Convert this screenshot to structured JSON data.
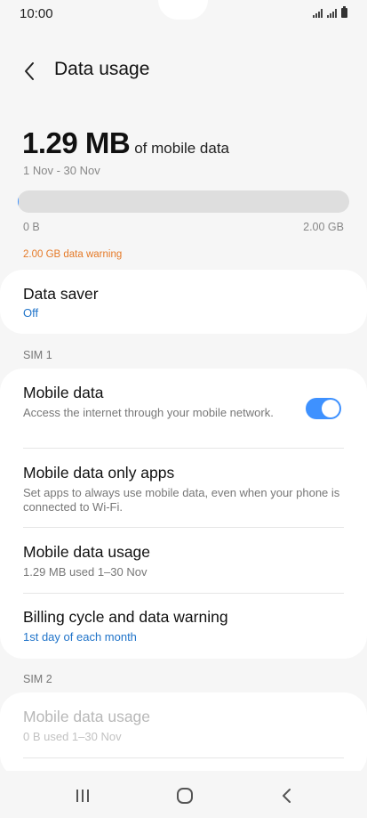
{
  "status_bar": {
    "time": "10:00"
  },
  "header": {
    "title": "Data usage"
  },
  "usage": {
    "amount": "1.29 MB",
    "suffix": "of mobile data",
    "period": "1 Nov - 30 Nov",
    "progress_fraction": 0.0006,
    "scale_min": "0 B",
    "scale_max": "2.00 GB",
    "warning": "2.00 GB data warning"
  },
  "data_saver": {
    "title": "Data saver",
    "status": "Off"
  },
  "sim1": {
    "label": "SIM 1",
    "mobile_data": {
      "title": "Mobile data",
      "subtitle": "Access the internet through your mobile network.",
      "enabled": true
    },
    "only_apps": {
      "title": "Mobile data only apps",
      "subtitle": "Set apps to always use mobile data, even when your phone is connected to Wi-Fi."
    },
    "usage": {
      "title": "Mobile data usage",
      "subtitle": "1.29 MB used 1–30 Nov"
    },
    "billing": {
      "title": "Billing cycle and data warning",
      "subtitle": "1st day of each month"
    }
  },
  "sim2": {
    "label": "SIM 2",
    "usage": {
      "title": "Mobile data usage",
      "subtitle": "0 B used 1–30 Nov"
    }
  },
  "colors": {
    "accent": "#3e91ff",
    "link": "#1f73c9",
    "warning": "#e57a28"
  },
  "icons": {
    "back": "chevron-left-icon",
    "recents": "recents-icon",
    "home": "home-icon",
    "nav_back": "nav-back-icon"
  }
}
